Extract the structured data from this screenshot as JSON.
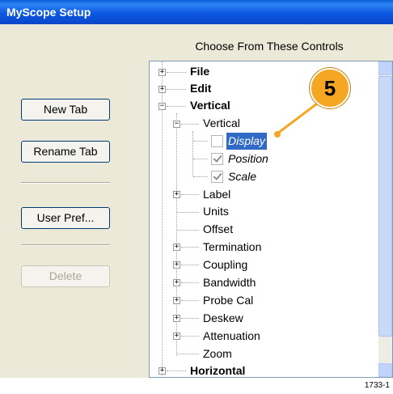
{
  "window": {
    "title": "MyScope Setup"
  },
  "choose_label": "Choose From These Controls",
  "buttons": {
    "new_tab": "New Tab",
    "rename_tab": "Rename Tab",
    "user_pref": "User Pref...",
    "delete": "Delete"
  },
  "tree": {
    "file": "File",
    "edit": "Edit",
    "vertical": "Vertical",
    "vertical_sub": "Vertical",
    "display": "Display",
    "position": "Position",
    "scale": "Scale",
    "label": "Label",
    "units": "Units",
    "offset": "Offset",
    "termination": "Termination",
    "coupling": "Coupling",
    "bandwidth": "Bandwidth",
    "probe_cal": "Probe Cal",
    "deskew": "Deskew",
    "attenuation": "Attenuation",
    "zoom": "Zoom",
    "horizontal": "Horizontal"
  },
  "checkboxes": {
    "display": false,
    "position": true,
    "scale": true
  },
  "callout": {
    "number": "5"
  },
  "figure_code": "1733-1",
  "colors": {
    "title_bar": "#0d58e3",
    "selection": "#316ac5",
    "callout": "#f5a623"
  }
}
